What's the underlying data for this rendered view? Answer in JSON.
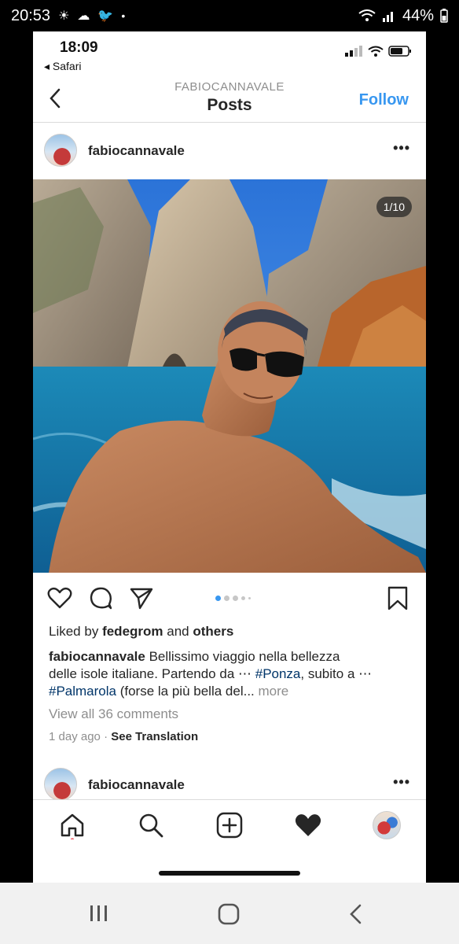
{
  "android_status": {
    "time": "20:53",
    "battery": "44%"
  },
  "ios_status": {
    "time": "18:09",
    "back_app": "Safari"
  },
  "nav": {
    "subtitle": "FABIOCANNAVALE",
    "title": "Posts",
    "follow_label": "Follow"
  },
  "post": {
    "username": "fabiocannavale",
    "image_counter": "1/10",
    "likes": {
      "prefix": "Liked by",
      "user": "fedegrom",
      "connector": "and",
      "others": "others"
    },
    "caption": {
      "user": "fabiocannavale",
      "line1": "Bellissimo viaggio nella bellezza",
      "line2_text": "delle isole italiane. Partendo da ⋯ ",
      "tag1": "#Ponza",
      "line2_after": ", subito a ⋯",
      "tag2": "#Palmarola",
      "line3_after": " (forse la più bella del... ",
      "more": "more"
    },
    "comments": "View all 36 comments",
    "time_ago": "1 day ago",
    "separator": "·",
    "see_translation": "See Translation"
  },
  "next_post": {
    "username": "fabiocannavale"
  },
  "colors": {
    "accent": "#3897f0",
    "text": "#262626",
    "muted": "#8e8e8e",
    "hashtag": "#003569"
  },
  "icons": [
    "heart-icon",
    "comment-icon",
    "share-icon",
    "bookmark-icon",
    "home-icon",
    "search-icon",
    "add-icon",
    "activity-icon",
    "profile-icon"
  ],
  "carousel": {
    "active_index": 0,
    "dot_count": 5
  }
}
